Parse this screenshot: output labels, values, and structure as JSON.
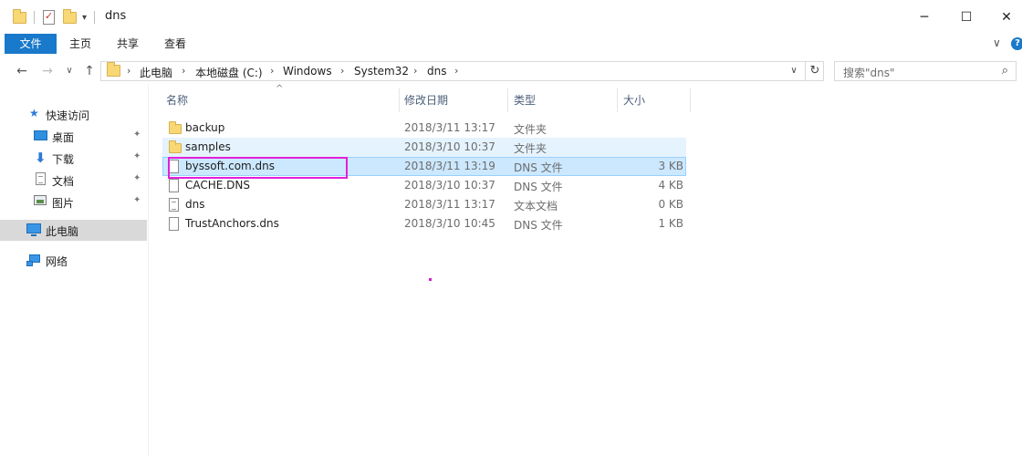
{
  "window": {
    "title": "dns",
    "minimize": "─",
    "maximize": "☐",
    "close": "✕"
  },
  "ribbon": {
    "tabs": [
      "文件",
      "主页",
      "共享",
      "查看"
    ],
    "expand": "∨",
    "help": "?"
  },
  "nav": {
    "back": "←",
    "forward": "→",
    "recent": "∨",
    "up": "↑",
    "breadcrumbs": [
      "此电脑",
      "本地磁盘 (C:)",
      "Windows",
      "System32",
      "dns"
    ],
    "separator": "›",
    "dropdown": "∨",
    "refresh": "↻",
    "search_placeholder": "搜索\"dns\"",
    "search_icon": "⌕"
  },
  "sidebar": {
    "quick_access": "快速访问",
    "pin": "📌",
    "items": [
      {
        "label": "桌面",
        "icon": "desktop-icon",
        "pinned": true
      },
      {
        "label": "下载",
        "icon": "download-icon",
        "pinned": true
      },
      {
        "label": "文档",
        "icon": "document-icon",
        "pinned": true
      },
      {
        "label": "图片",
        "icon": "pictures-icon",
        "pinned": true
      }
    ],
    "this_pc": "此电脑",
    "network": "网络"
  },
  "columns": {
    "name": "名称",
    "modified": "修改日期",
    "type": "类型",
    "size": "大小",
    "sort_indicator": "^"
  },
  "files": [
    {
      "name": "backup",
      "modified": "2018/3/11 13:17",
      "type": "文件夹",
      "size": "",
      "kind": "folder"
    },
    {
      "name": "samples",
      "modified": "2018/3/10 10:37",
      "type": "文件夹",
      "size": "",
      "kind": "folder"
    },
    {
      "name": "byssoft.com.dns",
      "modified": "2018/3/11 13:19",
      "type": "DNS 文件",
      "size": "3 KB",
      "kind": "file"
    },
    {
      "name": "CACHE.DNS",
      "modified": "2018/3/10 10:37",
      "type": "DNS 文件",
      "size": "4 KB",
      "kind": "file"
    },
    {
      "name": "dns",
      "modified": "2018/3/11 13:17",
      "type": "文本文档",
      "size": "0 KB",
      "kind": "text"
    },
    {
      "name": "TrustAnchors.dns",
      "modified": "2018/3/10 10:45",
      "type": "DNS 文件",
      "size": "1 KB",
      "kind": "file"
    }
  ],
  "colors": {
    "accent": "#1979ca",
    "selection": "#cce8ff",
    "hover": "#e5f3ff",
    "annotation": "#e020d8"
  }
}
